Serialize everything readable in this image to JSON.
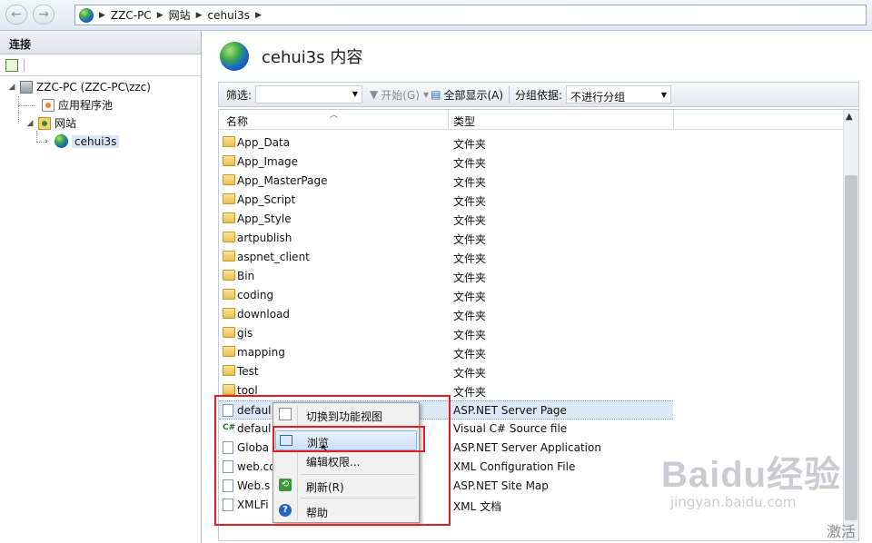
{
  "address_bar": {
    "crumbs": [
      "ZZC-PC",
      "网站",
      "cehui3s"
    ]
  },
  "connections": {
    "header": "连接",
    "tree": {
      "server": "ZZC-PC (ZZC-PC\\zzc)",
      "app_pools": "应用程序池",
      "sites": "网站",
      "site": "cehui3s"
    }
  },
  "content": {
    "title": "cehui3s 内容",
    "filter": {
      "label": "筛选:",
      "value": "",
      "start_label": "开始(G)",
      "show_all_label": "全部显示(A)",
      "group_label": "分组依据:",
      "group_value": "不进行分组"
    },
    "columns": {
      "name": "名称",
      "type": "类型"
    },
    "rows": [
      {
        "name": "App_Data",
        "type": "文件夹",
        "icon": "folder"
      },
      {
        "name": "App_Image",
        "type": "文件夹",
        "icon": "folder"
      },
      {
        "name": "App_MasterPage",
        "type": "文件夹",
        "icon": "folder"
      },
      {
        "name": "App_Script",
        "type": "文件夹",
        "icon": "folder"
      },
      {
        "name": "App_Style",
        "type": "文件夹",
        "icon": "folder"
      },
      {
        "name": "artpublish",
        "type": "文件夹",
        "icon": "folder"
      },
      {
        "name": "aspnet_client",
        "type": "文件夹",
        "icon": "folder"
      },
      {
        "name": "Bin",
        "type": "文件夹",
        "icon": "folder"
      },
      {
        "name": "coding",
        "type": "文件夹",
        "icon": "folder"
      },
      {
        "name": "download",
        "type": "文件夹",
        "icon": "folder"
      },
      {
        "name": "gis",
        "type": "文件夹",
        "icon": "folder"
      },
      {
        "name": "mapping",
        "type": "文件夹",
        "icon": "folder"
      },
      {
        "name": "Test",
        "type": "文件夹",
        "icon": "folder"
      },
      {
        "name": "tool",
        "type": "文件夹",
        "icon": "folder"
      },
      {
        "name": "defaul",
        "type": "ASP.NET Server Page",
        "icon": "aspx-page"
      },
      {
        "name": "defaul",
        "type": "Visual C# Source file",
        "icon": "csharp-file"
      },
      {
        "name": "Globa",
        "type": "ASP.NET Server Application",
        "icon": "asax-file"
      },
      {
        "name": "web.co",
        "type": "XML Configuration File",
        "icon": "config-file"
      },
      {
        "name": "Web.s",
        "type": "ASP.NET Site Map",
        "icon": "sitemap-file"
      },
      {
        "name": "XMLFi",
        "type": "XML 文档",
        "icon": "xml-file"
      }
    ]
  },
  "context_menu": {
    "items": [
      {
        "label": "切换到功能视图",
        "icon": "features-view-icon"
      },
      {
        "label": "浏览",
        "icon": "browse-icon"
      },
      {
        "label": "编辑权限...",
        "icon": ""
      },
      {
        "label": "刷新(R)",
        "icon": "refresh-icon"
      },
      {
        "label": "帮助",
        "icon": "help-icon"
      }
    ]
  },
  "watermark": {
    "logo": "Baidu经验",
    "sub": "jingyan.baidu.com"
  },
  "activation_text": "激活"
}
